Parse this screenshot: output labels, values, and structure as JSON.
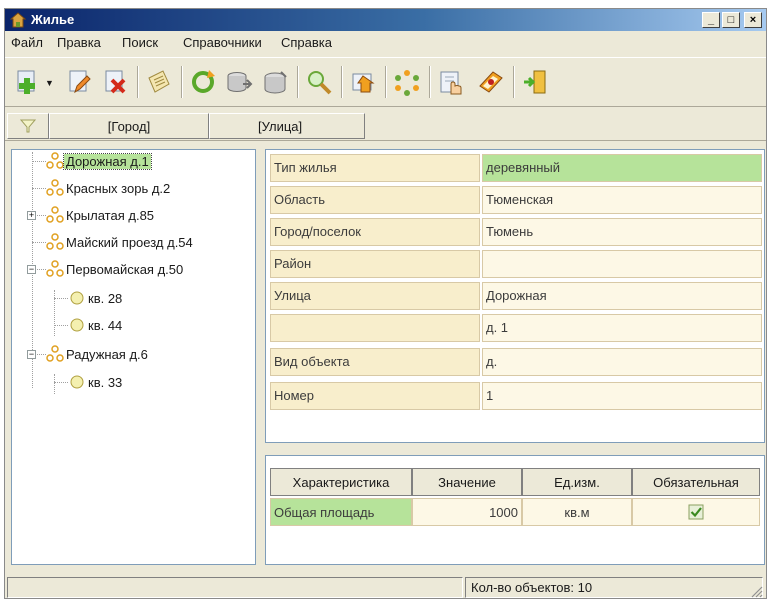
{
  "window": {
    "title": "Жилье"
  },
  "menu": [
    "Файл",
    "Правка",
    "Поиск",
    "Справочники",
    "Справка"
  ],
  "toolbar": {
    "buttons": [
      "add-icon",
      "edit-icon",
      "delete-icon",
      "notes-icon",
      "refresh-icon",
      "db-import-icon",
      "db-export-icon",
      "search-icon",
      "house-icon",
      "nodes-icon",
      "hand-card-icon",
      "book-icon",
      "exit-icon"
    ]
  },
  "filter": {
    "city": "[Город]",
    "street": "[Улица]"
  },
  "tree": [
    {
      "label": "Дорожная д.1",
      "selected": true
    },
    {
      "label": "Красных зорь д.2"
    },
    {
      "label": "Крылатая д.85",
      "expander": "+"
    },
    {
      "label": "Майский проезд д.54"
    },
    {
      "label": "Первомайская д.50",
      "expander": "−"
    },
    {
      "label": "кв. 28"
    },
    {
      "label": "кв. 44"
    },
    {
      "label": "Радужная д.6",
      "expander": "−"
    },
    {
      "label": "кв. 33"
    }
  ],
  "properties": [
    {
      "key": "Тип жилья",
      "value": "деревянный"
    },
    {
      "key": "Область",
      "value": "Тюменская"
    },
    {
      "key": "Город/поселок",
      "value": "Тюмень"
    },
    {
      "key": "Район",
      "value": ""
    },
    {
      "key": "Улица",
      "value": "Дорожная"
    },
    {
      "key": "",
      "value": "д. 1"
    },
    {
      "key": "Вид объекта",
      "value": "д."
    },
    {
      "key": "Номер",
      "value": "1"
    }
  ],
  "grid": {
    "headers": [
      "Характеристика",
      "Значение",
      "Ед.изм.",
      "Обязательная"
    ],
    "rows": [
      {
        "name": "Общая площадь",
        "value": "1000",
        "unit": "кв.м",
        "required": true
      }
    ]
  },
  "status": {
    "count": "Кол-во объектов: 10"
  },
  "colors": {
    "selection": "#b6e39a",
    "title_start": "#0a246a",
    "title_end": "#a6caf0"
  }
}
